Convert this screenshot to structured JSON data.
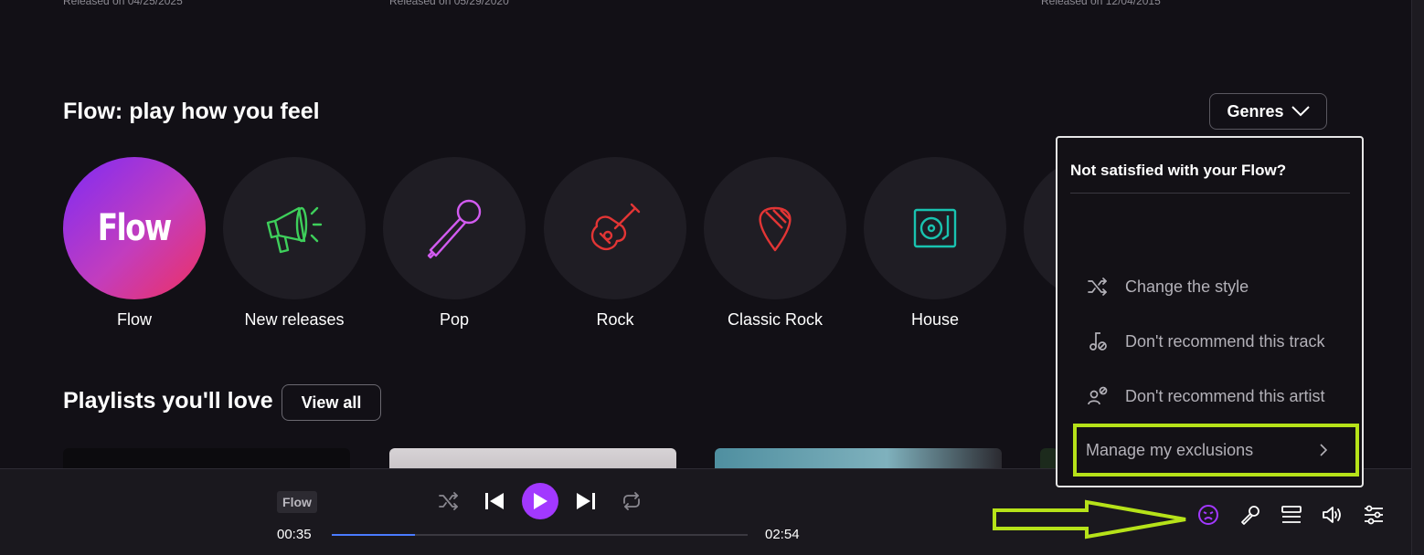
{
  "top_releases": [
    "Released on 04/25/2025",
    "Released on 05/29/2020",
    "Released on 12/04/2015"
  ],
  "flow_section": {
    "title": "Flow: play how you feel",
    "genres_label": "Genres",
    "tiles": [
      {
        "label": "Flow",
        "logo_text": "Flow",
        "icon": "flow-logo"
      },
      {
        "label": "New releases",
        "icon": "megaphone-icon",
        "color": "#3ecf5b"
      },
      {
        "label": "Pop",
        "icon": "microphone-icon",
        "color": "#d25bf0"
      },
      {
        "label": "Rock",
        "icon": "guitar-icon",
        "color": "#e23535"
      },
      {
        "label": "Classic Rock",
        "icon": "guitar-pick-icon",
        "color": "#e23535"
      },
      {
        "label": "House",
        "icon": "turntable-icon",
        "color": "#19c3b0"
      }
    ]
  },
  "playlists_section": {
    "title": "Playlists you'll love",
    "view_all_label": "View all"
  },
  "player": {
    "track_tag": "Flow",
    "elapsed": "00:35",
    "duration": "02:54",
    "progress": 0.2
  },
  "popup": {
    "title": "Not satisfied with your Flow?",
    "items": [
      {
        "label": "Change the style",
        "icon": "shuffle-icon"
      },
      {
        "label": "Don't recommend this track",
        "icon": "music-note-block-icon"
      },
      {
        "label": "Don't recommend this artist",
        "icon": "user-block-icon"
      }
    ],
    "manage_label": "Manage my exclusions"
  },
  "colors": {
    "accent": "#a238ff",
    "highlight": "#b6e219",
    "progress": "#4a7bff",
    "background": "#121016"
  }
}
